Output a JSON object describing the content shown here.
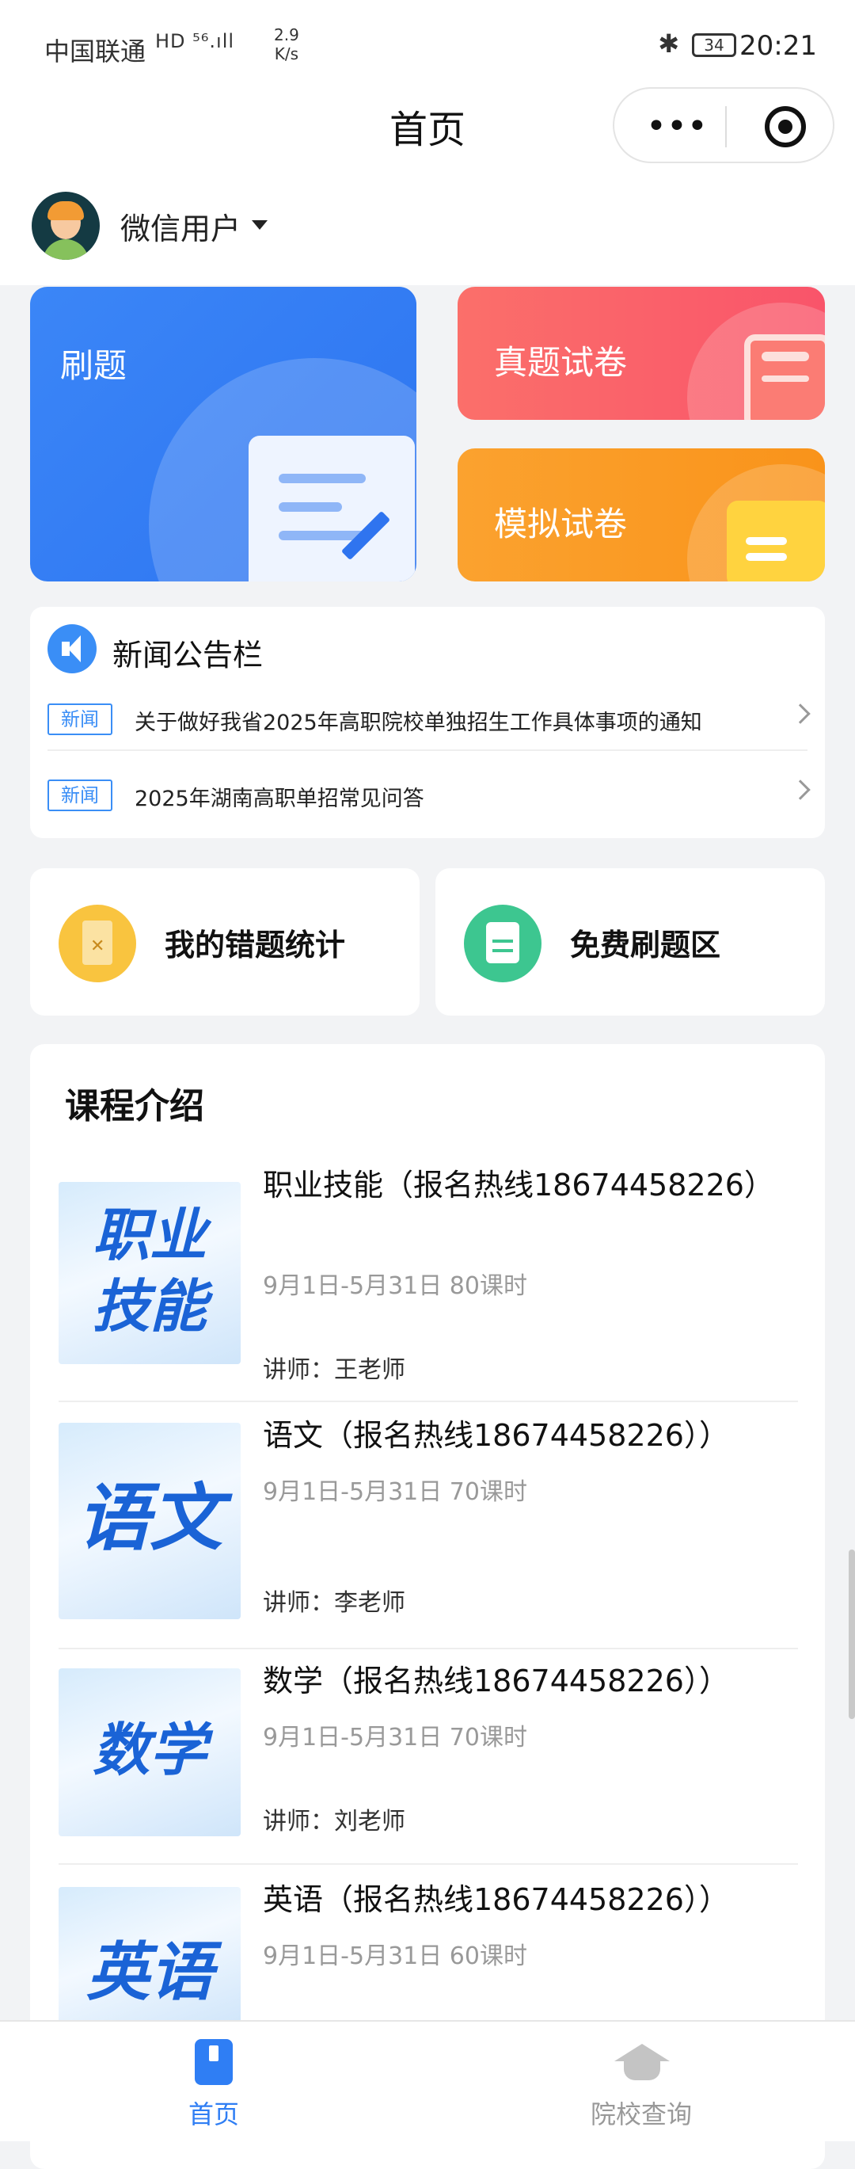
{
  "status_bar": {
    "carrier": "中国联通",
    "signal": "HD ⁵⁶.ıll",
    "net_speed_value": "2.9",
    "net_speed_unit": "K/s",
    "battery": "34",
    "time": "20:21",
    "bluetooth_glyph": "✱"
  },
  "header": {
    "title": "首页",
    "more_glyph": "•••"
  },
  "user": {
    "name": "微信用户"
  },
  "cards": {
    "practice": "刷题",
    "real_papers": "真题试卷",
    "mock_papers": "模拟试卷"
  },
  "news": {
    "heading": "新闻公告栏",
    "items": [
      {
        "tag": "新闻",
        "text": "关于做好我省2025年高职院校单独招生工作具体事项的通知"
      },
      {
        "tag": "新闻",
        "text": "2025年湖南高职单招常见问答"
      }
    ]
  },
  "quick": {
    "mistakes": "我的错题统计",
    "free_practice": "免费刷题区",
    "mistakes_icon_glyph": "✕"
  },
  "courses": {
    "heading": "课程介绍",
    "items": [
      {
        "thumb_text": "职业技能",
        "title": "职业技能（报名热线18674458226）",
        "meta": "9月1日-5月31日 80课时",
        "teacher": "讲师：王老师"
      },
      {
        "thumb_text": "语文",
        "title": "语文（报名热线18674458226））",
        "meta": "9月1日-5月31日 70课时",
        "teacher": "讲师：李老师"
      },
      {
        "thumb_text": "数学",
        "title": "数学（报名热线18674458226））",
        "meta": "9月1日-5月31日 70课时",
        "teacher": "讲师：刘老师"
      },
      {
        "thumb_text": "英语",
        "title": "英语（报名热线18674458226））",
        "meta": "9月1日-5月31日 60课时",
        "teacher": ""
      }
    ]
  },
  "tabbar": {
    "home": "首页",
    "school": "院校查询"
  },
  "colors": {
    "accent_blue": "#2f7ef4",
    "card_red": "#f9546a",
    "card_orange": "#f9931a",
    "green": "#3dc690",
    "yellow": "#f9c43f"
  }
}
